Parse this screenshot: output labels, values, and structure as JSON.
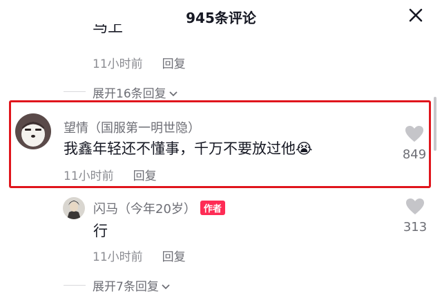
{
  "header": {
    "title": "945条评论"
  },
  "thread1": {
    "clipped_text": "马上",
    "time": "11小时前",
    "reply_label": "回复",
    "expand_label": "展开16条回复"
  },
  "comment_main": {
    "username": "望情（国服第一明世隐）",
    "text": "我鑫年轻还不懂事，千万不要放过他😭",
    "time": "11小时前",
    "reply_label": "回复",
    "likes": "849"
  },
  "comment_reply": {
    "username": "闪马（今年20岁）",
    "badge": "作者",
    "text": "行",
    "time": "11小时前",
    "reply_label": "回复",
    "likes": "313",
    "expand_label": "展开7条回复"
  },
  "colors": {
    "highlight": "#e0151c",
    "badge": "#fe2c55",
    "secondary_text": "#8a8b91"
  },
  "icons": [
    "close-icon",
    "heart-icon",
    "chevron-down-icon"
  ]
}
